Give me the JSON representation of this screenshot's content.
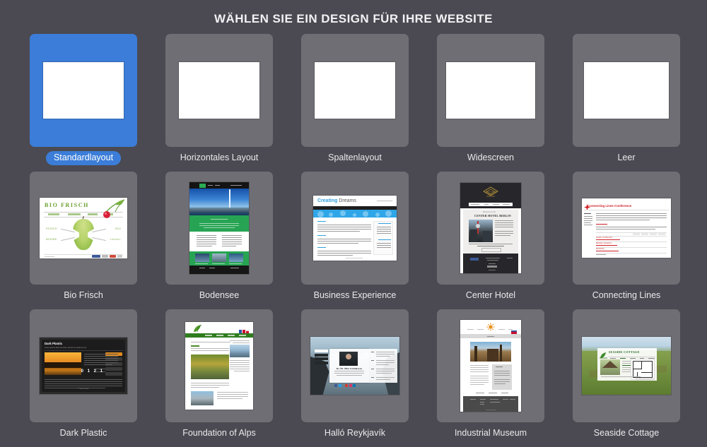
{
  "page": {
    "title": "WÄHLEN SIE EIN DESIGN FÜR IHRE WEBSITE",
    "background_color": "#4b4a52",
    "tile_background_color": "#6f6e74",
    "selection_color": "#3b7dd8",
    "label_color": "#e9e9ec"
  },
  "templates": [
    {
      "id": "standardlayout",
      "label": "Standardlayout",
      "selected": true,
      "kind": "wireframe"
    },
    {
      "id": "horizontales-layout",
      "label": "Horizontales Layout",
      "selected": false,
      "kind": "wireframe"
    },
    {
      "id": "spaltenlayout",
      "label": "Spaltenlayout",
      "selected": false,
      "kind": "wireframe"
    },
    {
      "id": "widescreen",
      "label": "Widescreen",
      "selected": false,
      "kind": "wireframe"
    },
    {
      "id": "leer",
      "label": "Leer",
      "selected": false,
      "kind": "wireframe"
    },
    {
      "id": "bio-frisch",
      "label": "Bio Frisch",
      "selected": false,
      "kind": "preview"
    },
    {
      "id": "bodensee",
      "label": "Bodensee",
      "selected": false,
      "kind": "preview"
    },
    {
      "id": "business-experience",
      "label": "Business Experience",
      "selected": false,
      "kind": "preview"
    },
    {
      "id": "center-hotel",
      "label": "Center Hotel",
      "selected": false,
      "kind": "preview"
    },
    {
      "id": "connecting-lines",
      "label": "Connecting Lines",
      "selected": false,
      "kind": "preview"
    },
    {
      "id": "dark-plastic",
      "label": "Dark Plastic",
      "selected": false,
      "kind": "preview"
    },
    {
      "id": "foundation-of-alps",
      "label": "Foundation of Alps",
      "selected": false,
      "kind": "preview"
    },
    {
      "id": "hallo-reykjavik",
      "label": "Halló Reykjavík",
      "selected": false,
      "kind": "preview"
    },
    {
      "id": "industrial-museum",
      "label": "Industrial Museum",
      "selected": false,
      "kind": "preview"
    },
    {
      "id": "seaside-cottage",
      "label": "Seaside Cottage",
      "selected": false,
      "kind": "preview"
    }
  ],
  "previews": {
    "bio_frisch": {
      "site_title": "BIO FRISCH",
      "labels": [
        "FRISCH",
        "GESUND",
        "BIO",
        "Lecker"
      ]
    },
    "business": {
      "brand_strong": "Creating",
      "brand_light": "Dreams"
    },
    "center_hotel": {
      "eyebrow": "Welcome to the",
      "heading": "CENTER HOTEL BERLIN"
    },
    "connecting": {
      "heading": "Connecting Lines Conference"
    },
    "dark_plastic": {
      "heading": "Dark Plastic",
      "subheading": "Lorem ipsum dolor sit amet, elit elit ut mauris ac est",
      "counter": "0 1 2 1"
    },
    "hallo": {
      "name": "Dr. Í  Dr. Ólfur Þórhallsson"
    },
    "seaside": {
      "heading": "SEASIDE COTTAGE"
    }
  }
}
